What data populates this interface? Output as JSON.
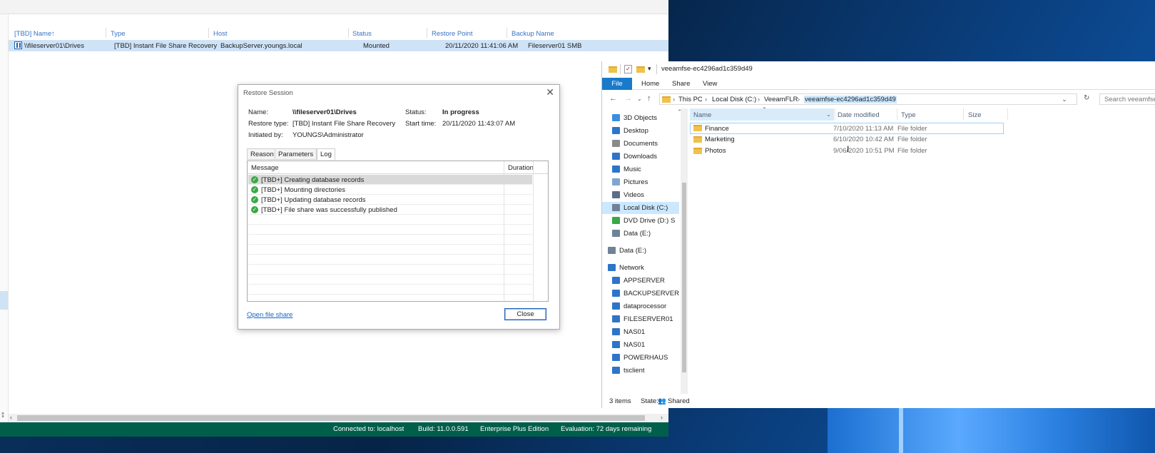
{
  "veeam": {
    "columns": [
      "[TBD] Name",
      "Type",
      "Host",
      "Status",
      "Restore Point",
      "Backup Name"
    ],
    "sort_arrow": "↑",
    "row": {
      "name": "\\\\fileserver01\\Drives",
      "type": "[TBD] Instant File Share Recovery",
      "host": "BackupServer.youngs.local",
      "status": "Mounted",
      "restore_point": "20/11/2020 11:41:06 AM",
      "backup_name": "Fileserver01 SMB"
    },
    "status_bar": {
      "connected": "Connected to: localhost",
      "build": "Build: 11.0.0.591",
      "edition": "Enterprise Plus Edition",
      "evaluation": "Evaluation: 72 days remaining"
    },
    "left_glyph": "⁑"
  },
  "dialog": {
    "title": "Restore Session",
    "close_glyph": "✕",
    "name_label": "Name:",
    "name_value": "\\\\fileserver01\\Drives",
    "restore_type_label": "Restore type:",
    "restore_type_value": "[TBD] Instant File Share Recovery",
    "initiated_label": "Initiated by:",
    "initiated_value": "YOUNGS\\Administrator",
    "status_label": "Status:",
    "status_value": "In progress",
    "start_label": "Start time:",
    "start_value": "20/11/2020 11:43:07 AM",
    "tabs": [
      "Reason",
      "Parameters",
      "Log"
    ],
    "log_columns": [
      "Message",
      "Duration"
    ],
    "log": [
      "[TBD+] Creating database records",
      "[TBD+] Mounting directories",
      "[TBD+] Updating database records",
      "[TBD+] File share was successfully published"
    ],
    "open_link": "Open file share",
    "close_button": "Close"
  },
  "explorer": {
    "title": "veeamfse-ec4296ad1c359d49",
    "ribbon_tabs": [
      "File",
      "Home",
      "Share",
      "View"
    ],
    "breadcrumbs": [
      "This PC",
      "Local Disk (C:)",
      "VeeamFLR",
      "veeamfse-ec4296ad1c359d49"
    ],
    "search_placeholder": "Search veeamfse-",
    "nav_items": [
      {
        "label": "3D Objects",
        "icon": "cube-icon",
        "color": "#3b8fe0"
      },
      {
        "label": "Desktop",
        "icon": "desktop-icon",
        "color": "#2e74c9"
      },
      {
        "label": "Documents",
        "icon": "documents-icon",
        "color": "#8a8a8a"
      },
      {
        "label": "Downloads",
        "icon": "download-icon",
        "color": "#2e74c9"
      },
      {
        "label": "Music",
        "icon": "music-icon",
        "color": "#2e74c9"
      },
      {
        "label": "Pictures",
        "icon": "pictures-icon",
        "color": "#7fa6cf"
      },
      {
        "label": "Videos",
        "icon": "videos-icon",
        "color": "#5b6e86"
      },
      {
        "label": "Local Disk (C:)",
        "icon": "drive-icon",
        "color": "#6f8296"
      },
      {
        "label": "DVD Drive (D:) S",
        "icon": "dvd-icon",
        "color": "#3aa845"
      },
      {
        "label": "Data (E:)",
        "icon": "drive-icon",
        "color": "#6f8296"
      },
      {
        "label": "Data (E:)",
        "icon": "drive-icon",
        "color": "#6f8296"
      },
      {
        "label": "Network",
        "icon": "network-icon",
        "color": "#2e74c9"
      },
      {
        "label": "APPSERVER",
        "icon": "computer-icon",
        "color": "#2e74c9"
      },
      {
        "label": "BACKUPSERVER",
        "icon": "computer-icon",
        "color": "#2e74c9"
      },
      {
        "label": "dataprocessor",
        "icon": "computer-icon",
        "color": "#2e74c9"
      },
      {
        "label": "FILESERVER01",
        "icon": "computer-icon",
        "color": "#2e74c9"
      },
      {
        "label": "NAS01",
        "icon": "computer-icon",
        "color": "#2e74c9"
      },
      {
        "label": "NAS01",
        "icon": "computer-icon",
        "color": "#2e74c9"
      },
      {
        "label": "POWERHAUS",
        "icon": "computer-icon",
        "color": "#2e74c9"
      },
      {
        "label": "tsclient",
        "icon": "computer-icon",
        "color": "#2e74c9"
      }
    ],
    "file_columns": [
      "Name",
      "Date modified",
      "Type",
      "Size"
    ],
    "files": [
      {
        "name": "Finance",
        "date": "7/10/2020 11:13 AM",
        "type": "File folder"
      },
      {
        "name": "Marketing",
        "date": "6/10/2020 10:42 AM",
        "type": "File folder"
      },
      {
        "name": "Photos",
        "date": "9/06/2020 10:51 PM",
        "type": "File folder"
      }
    ],
    "status_items": "3 items",
    "status_state": "State:",
    "status_shared": "Shared"
  }
}
